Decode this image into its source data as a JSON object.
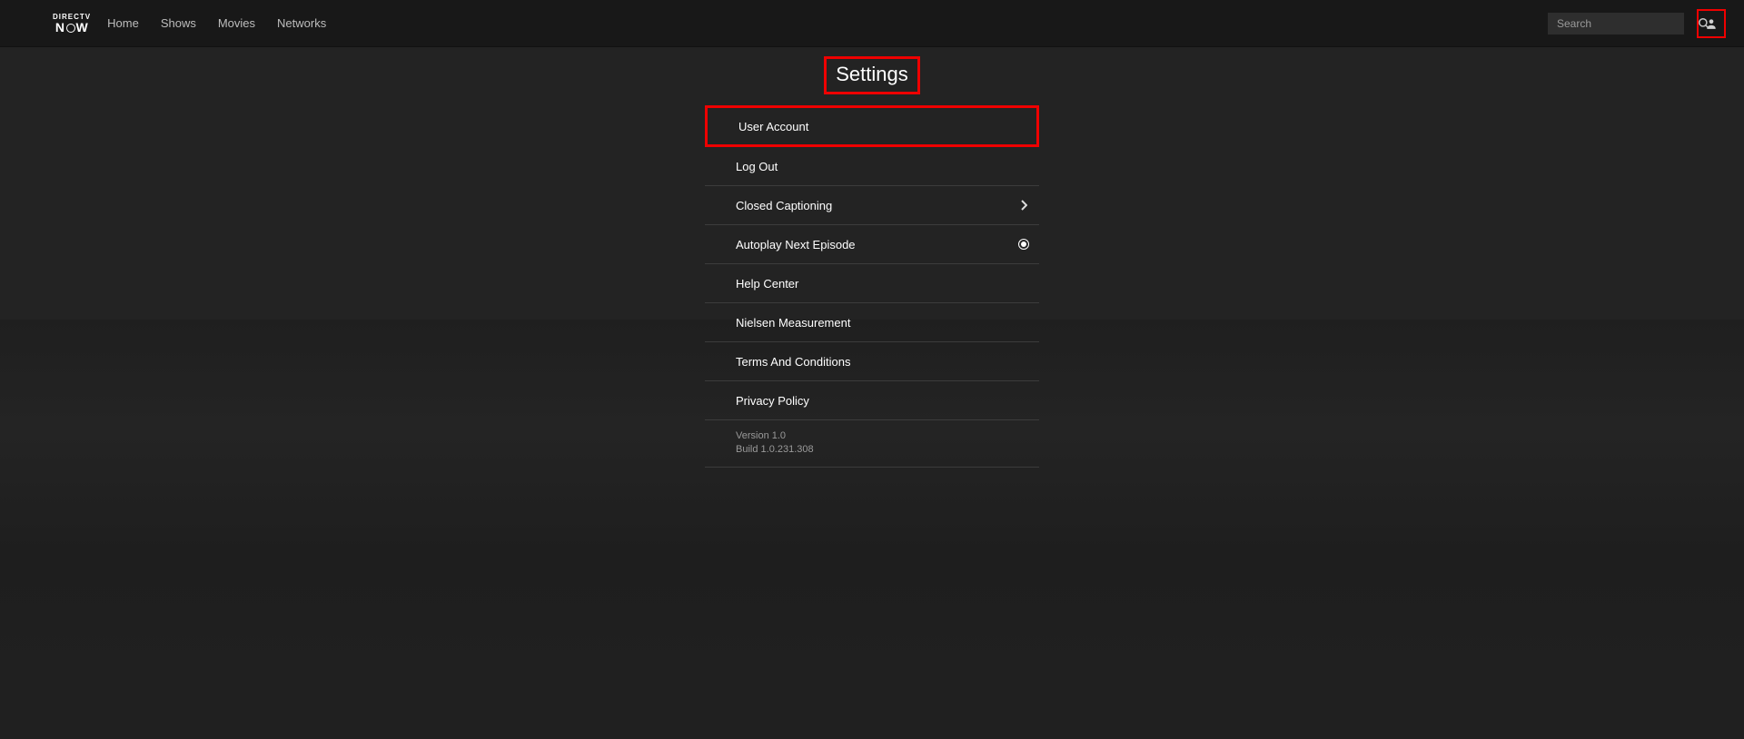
{
  "header": {
    "logo_top": "DIRECTV",
    "logo_bottom_pre": "N",
    "logo_bottom_post": "W",
    "nav": [
      "Home",
      "Shows",
      "Movies",
      "Networks"
    ],
    "search_placeholder": "Search"
  },
  "page": {
    "title": "Settings"
  },
  "settings": {
    "items": [
      {
        "label": "User Account",
        "type": "highlight"
      },
      {
        "label": "Log Out",
        "type": "plain"
      },
      {
        "label": "Closed Captioning",
        "type": "chevron"
      },
      {
        "label": "Autoplay Next Episode",
        "type": "radio"
      },
      {
        "label": "Help Center",
        "type": "plain"
      },
      {
        "label": "Nielsen Measurement",
        "type": "plain"
      },
      {
        "label": "Terms And Conditions",
        "type": "plain"
      },
      {
        "label": "Privacy Policy",
        "type": "plain"
      }
    ],
    "version_line": "Version 1.0",
    "build_line": "Build 1.0.231.308"
  }
}
